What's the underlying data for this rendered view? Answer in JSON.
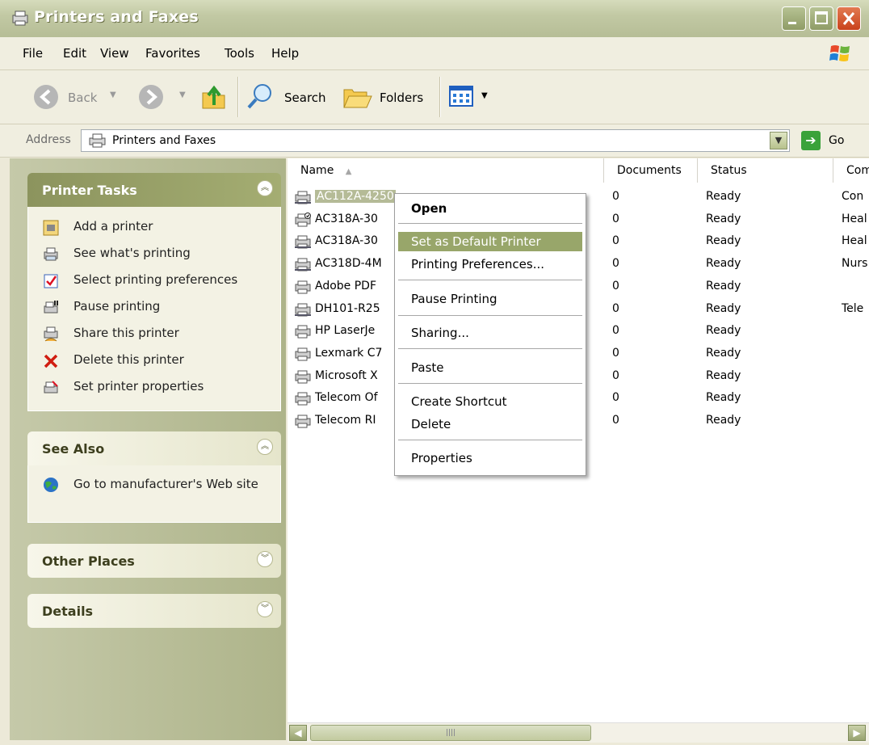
{
  "window": {
    "title": "Printers and Faxes"
  },
  "menu": [
    "File",
    "Edit",
    "View",
    "Favorites",
    "Tools",
    "Help"
  ],
  "toolbar": {
    "back_label": "Back",
    "search_label": "Search",
    "folders_label": "Folders"
  },
  "address": {
    "label": "Address",
    "value": "Printers and Faxes",
    "go_label": "Go"
  },
  "sidebar": {
    "printer_tasks": {
      "title": "Printer Tasks",
      "items": [
        "Add a printer",
        "See what's printing",
        "Select printing preferences",
        "Pause printing",
        "Share this printer",
        "Delete this printer",
        "Set printer properties"
      ]
    },
    "see_also": {
      "title": "See Also",
      "items": [
        "Go to manufacturer's Web site"
      ]
    },
    "other_places": {
      "title": "Other Places"
    },
    "details": {
      "title": "Details"
    }
  },
  "list": {
    "columns": [
      "Name",
      "Documents",
      "Status",
      "Com"
    ],
    "rows": [
      {
        "name": "AC112A-4250",
        "docs": "0",
        "status": "Ready",
        "comment": "Con"
      },
      {
        "name": "AC318A-30",
        "docs": "0",
        "status": "Ready",
        "comment": "Heal"
      },
      {
        "name": "AC318A-30",
        "docs": "0",
        "status": "Ready",
        "comment": "Heal"
      },
      {
        "name": "AC318D-4M",
        "docs": "0",
        "status": "Ready",
        "comment": "Nurs"
      },
      {
        "name": "Adobe PDF",
        "docs": "0",
        "status": "Ready",
        "comment": ""
      },
      {
        "name": "DH101-R25",
        "docs": "0",
        "status": "Ready",
        "comment": "Tele"
      },
      {
        "name": "HP LaserJe",
        "docs": "0",
        "status": "Ready",
        "comment": ""
      },
      {
        "name": "Lexmark C7",
        "docs": "0",
        "status": "Ready",
        "comment": ""
      },
      {
        "name": "Microsoft X",
        "docs": "0",
        "status": "Ready",
        "comment": ""
      },
      {
        "name": "Telecom Of",
        "docs": "0",
        "status": "Ready",
        "comment": ""
      },
      {
        "name": "Telecom RI",
        "docs": "0",
        "status": "Ready",
        "comment": ""
      }
    ]
  },
  "context_menu": {
    "open": "Open",
    "set_default": "Set as Default Printer",
    "printing_prefs": "Printing Preferences...",
    "pause": "Pause Printing",
    "sharing": "Sharing...",
    "paste": "Paste",
    "create_shortcut": "Create Shortcut",
    "delete": "Delete",
    "properties": "Properties"
  },
  "colors": {
    "menu_highlight": "#98a66a",
    "titlebar": "#c2c9a4",
    "close": "#c9421b"
  }
}
